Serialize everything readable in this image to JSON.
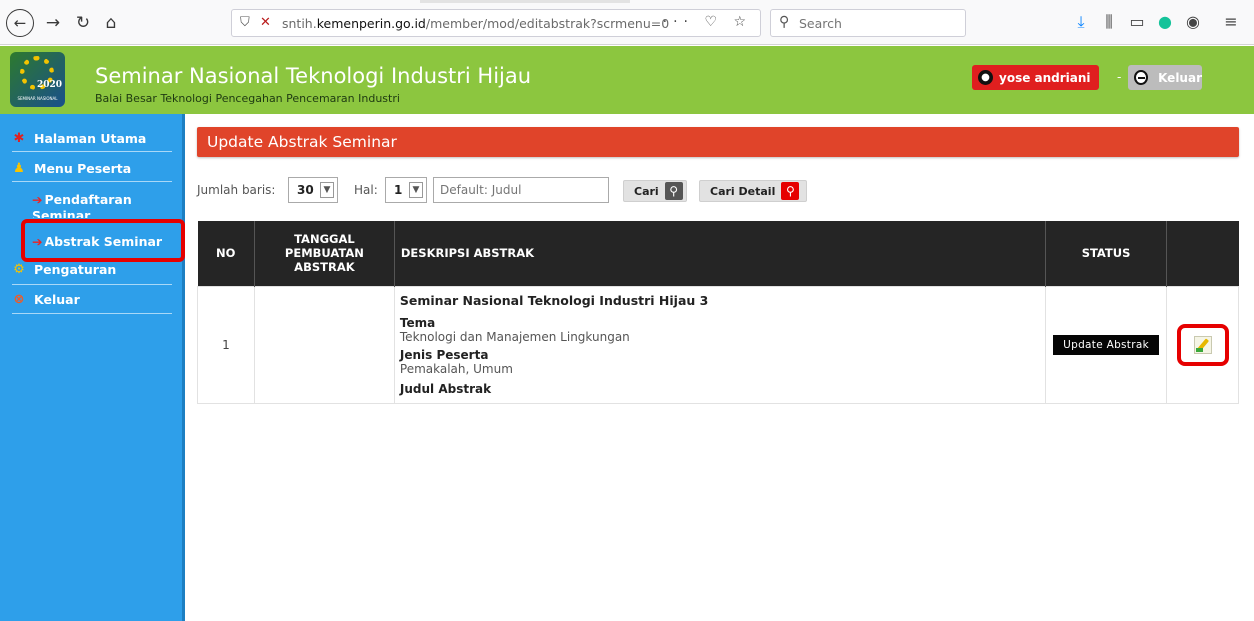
{
  "browser": {
    "url_prefix": "sntih.",
    "url_domain": "kemenperin.go.id",
    "url_path": "/member/mod/editabstrak?scrmenu=0",
    "search_placeholder": "Search",
    "url_actions": "··· ♡ ☆"
  },
  "header": {
    "logo_year": "2020",
    "logo_caption": "SEMINAR NASIONAL",
    "title": "Seminar Nasional Teknologi Industri Hijau",
    "subtitle": "Balai Besar Teknologi Pencegahan Pencemaran Industri",
    "user_name": "yose andriani",
    "separator": "-",
    "logout_label": "Keluar"
  },
  "sidebar": {
    "items": [
      {
        "label": "Halaman Utama",
        "icon": "home-icon"
      },
      {
        "label": "Menu Peserta",
        "icon": "user-icon"
      },
      {
        "label": "Pendaftaran Seminar",
        "icon": "arrow-icon"
      },
      {
        "label": "Abstrak Seminar",
        "icon": "arrow-icon"
      },
      {
        "label": "Pengaturan",
        "icon": "gear-icon"
      },
      {
        "label": "Keluar",
        "icon": "exit-icon"
      }
    ]
  },
  "main": {
    "title": "Update Abstrak Seminar",
    "filter": {
      "rows_label": "Jumlah baris:",
      "rows_value": "30",
      "page_label": "Hal:",
      "page_value": "1",
      "search_placeholder": "Default: Judul",
      "search_button": "Cari",
      "detail_button": "Cari Detail"
    },
    "table": {
      "headers": [
        "NO",
        "TANGGAL PEMBUATAN ABSTRAK",
        "DESKRIPSI ABSTRAK",
        "STATUS",
        ""
      ],
      "rows": [
        {
          "no": "1",
          "tanggal": "",
          "title": "Seminar Nasional Teknologi Industri Hijau 3",
          "tema_label": "Tema",
          "tema_value": "Teknologi dan Manajemen Lingkungan",
          "jenis_label": "Jenis Peserta",
          "jenis_value": "Pemakalah, Umum",
          "judul_label": "Judul Abstrak",
          "status": "Update Abstrak"
        }
      ]
    }
  }
}
